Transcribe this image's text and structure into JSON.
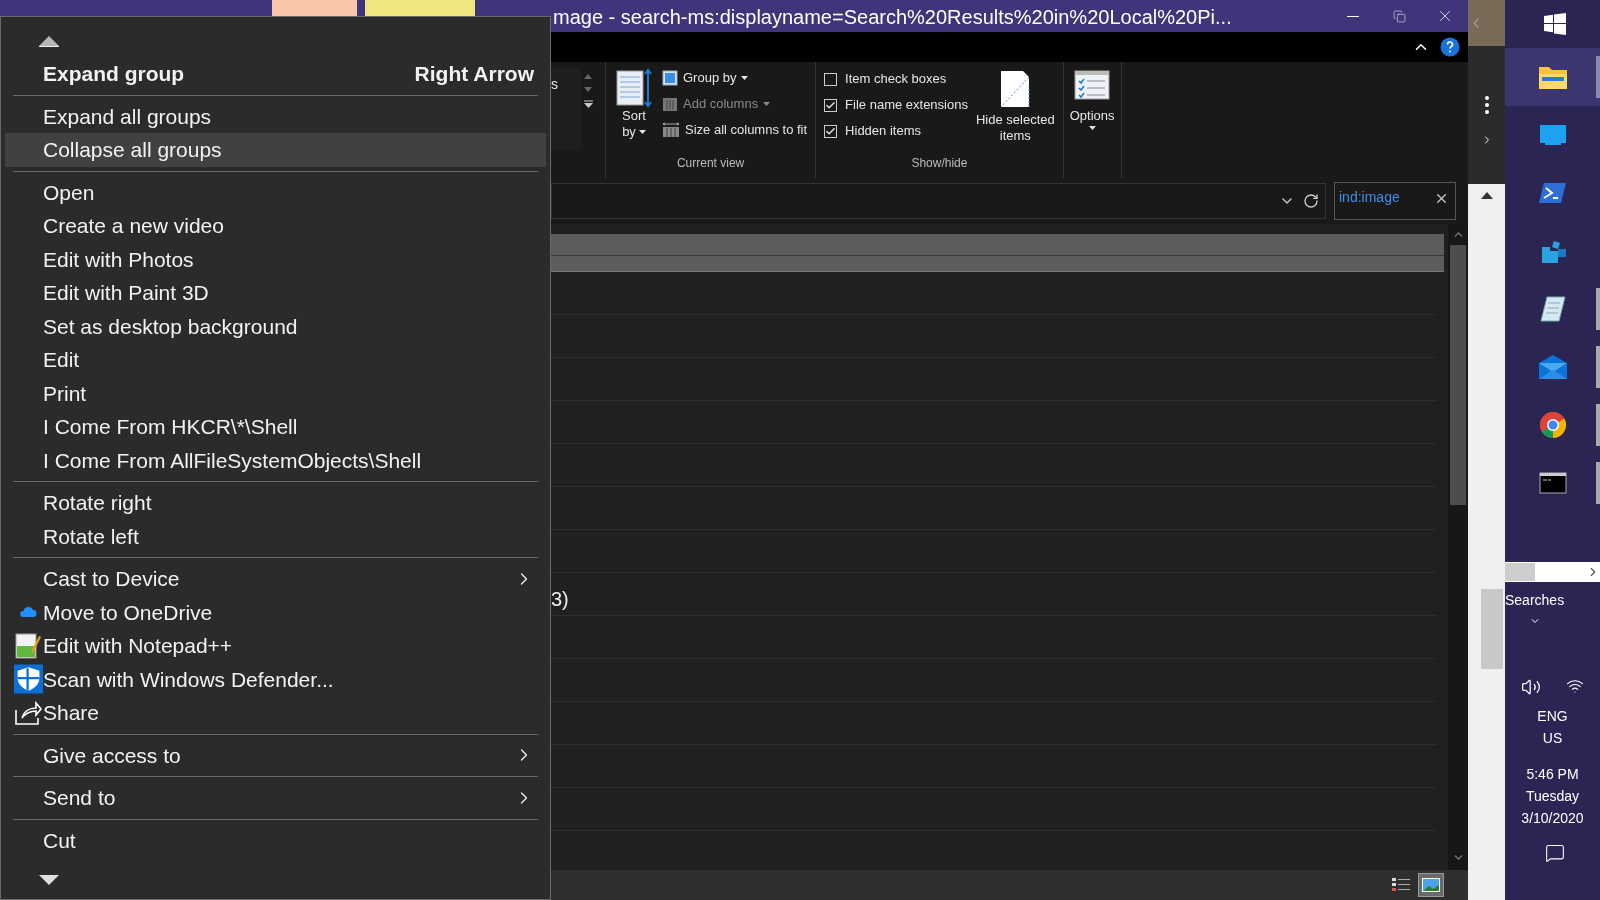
{
  "title_bar": {
    "contextual_tabs": [
      {
        "color": "#f9c6a9"
      },
      {
        "color": "#efe67d"
      }
    ],
    "title": "mage - search-ms:displayname=Search%20Results%20in%20Local%20Pi..."
  },
  "ribbon": {
    "gallery_fragment": "s",
    "current_view": {
      "label": "Current view",
      "sort_by": [
        "Sort",
        "by"
      ],
      "items": [
        {
          "kind": "group",
          "label": "Group by",
          "disabled": false
        },
        {
          "kind": "columns",
          "label": "Add columns",
          "disabled": true
        },
        {
          "kind": "size",
          "label": "Size all columns to fit",
          "disabled": false
        }
      ]
    },
    "show_hide": {
      "label": "Show/hide",
      "checkboxes": [
        {
          "label": "Item check boxes",
          "checked": false
        },
        {
          "label": "File name extensions",
          "checked": true
        },
        {
          "label": "Hidden items",
          "checked": true
        }
      ],
      "hide_selected": [
        "Hide selected",
        "items"
      ]
    },
    "options": "Options"
  },
  "search": {
    "value": "ind:image"
  },
  "content": {
    "group_label_fragment": "3)"
  },
  "status_bar": {
    "view_buttons": [
      {
        "kind": "details",
        "selected": false
      },
      {
        "kind": "large_icons",
        "selected": true
      }
    ]
  },
  "context_menu": {
    "sections": [
      [
        {
          "label": "Expand group",
          "shortcut": "Right Arrow",
          "default": true,
          "selected": false,
          "submenu": false
        }
      ],
      [
        {
          "label": "Expand all groups",
          "default": false,
          "selected": false,
          "submenu": false
        },
        {
          "label": "Collapse all groups",
          "default": false,
          "selected": true,
          "submenu": false
        }
      ],
      [
        {
          "label": "Open",
          "default": false,
          "selected": false,
          "submenu": false
        },
        {
          "label": "Create a new video",
          "default": false,
          "selected": false,
          "submenu": false
        },
        {
          "label": "Edit with Photos",
          "default": false,
          "selected": false,
          "submenu": false
        },
        {
          "label": "Edit with Paint 3D",
          "default": false,
          "selected": false,
          "submenu": false
        },
        {
          "label": "Set as desktop background",
          "default": false,
          "selected": false,
          "submenu": false
        },
        {
          "label": "Edit",
          "default": false,
          "selected": false,
          "submenu": false
        },
        {
          "label": "Print",
          "default": false,
          "selected": false,
          "submenu": false
        },
        {
          "label": "I Come From HKCR\\*\\Shell",
          "default": false,
          "selected": false,
          "submenu": false
        },
        {
          "label": "I Come From AllFileSystemObjects\\Shell",
          "default": false,
          "selected": false,
          "submenu": false
        }
      ],
      [
        {
          "label": "Rotate right",
          "default": false,
          "selected": false,
          "submenu": false
        },
        {
          "label": "Rotate left",
          "default": false,
          "selected": false,
          "submenu": false
        }
      ],
      [
        {
          "label": "Cast to Device",
          "default": false,
          "selected": false,
          "submenu": true
        },
        {
          "label": "Move to OneDrive",
          "kind": "cloud",
          "default": false,
          "selected": false,
          "submenu": false
        },
        {
          "label": "Edit with Notepad++",
          "kind": "notepad",
          "default": false,
          "selected": false,
          "submenu": false
        },
        {
          "label": "Scan with Windows Defender...",
          "kind": "shield",
          "default": false,
          "selected": false,
          "submenu": false
        },
        {
          "label": "Share",
          "kind": "share",
          "default": false,
          "selected": false,
          "submenu": false
        }
      ],
      [
        {
          "label": "Give access to",
          "default": false,
          "selected": false,
          "submenu": true
        }
      ],
      [
        {
          "label": "Send to",
          "default": false,
          "selected": false,
          "submenu": true
        }
      ],
      [
        {
          "label": "Cut",
          "default": false,
          "selected": false,
          "submenu": false
        }
      ]
    ]
  },
  "taskbar": {
    "apps": [
      {
        "kind": "folder",
        "selected": true,
        "running": false
      },
      {
        "kind": "screen",
        "selected": false,
        "running": false
      },
      {
        "kind": "powershell",
        "selected": false,
        "running": false
      },
      {
        "kind": "registry",
        "selected": false,
        "running": false
      },
      {
        "kind": "notepad",
        "selected": false,
        "running": true
      },
      {
        "kind": "mail",
        "selected": false,
        "running": true
      },
      {
        "kind": "chrome",
        "selected": false,
        "running": true
      },
      {
        "kind": "terminal",
        "selected": false,
        "running": true
      }
    ],
    "searches": "Searches",
    "language": [
      "ENG",
      "US"
    ],
    "time": "5:46 PM",
    "day": "Tuesday",
    "date": "3/10/2020"
  }
}
